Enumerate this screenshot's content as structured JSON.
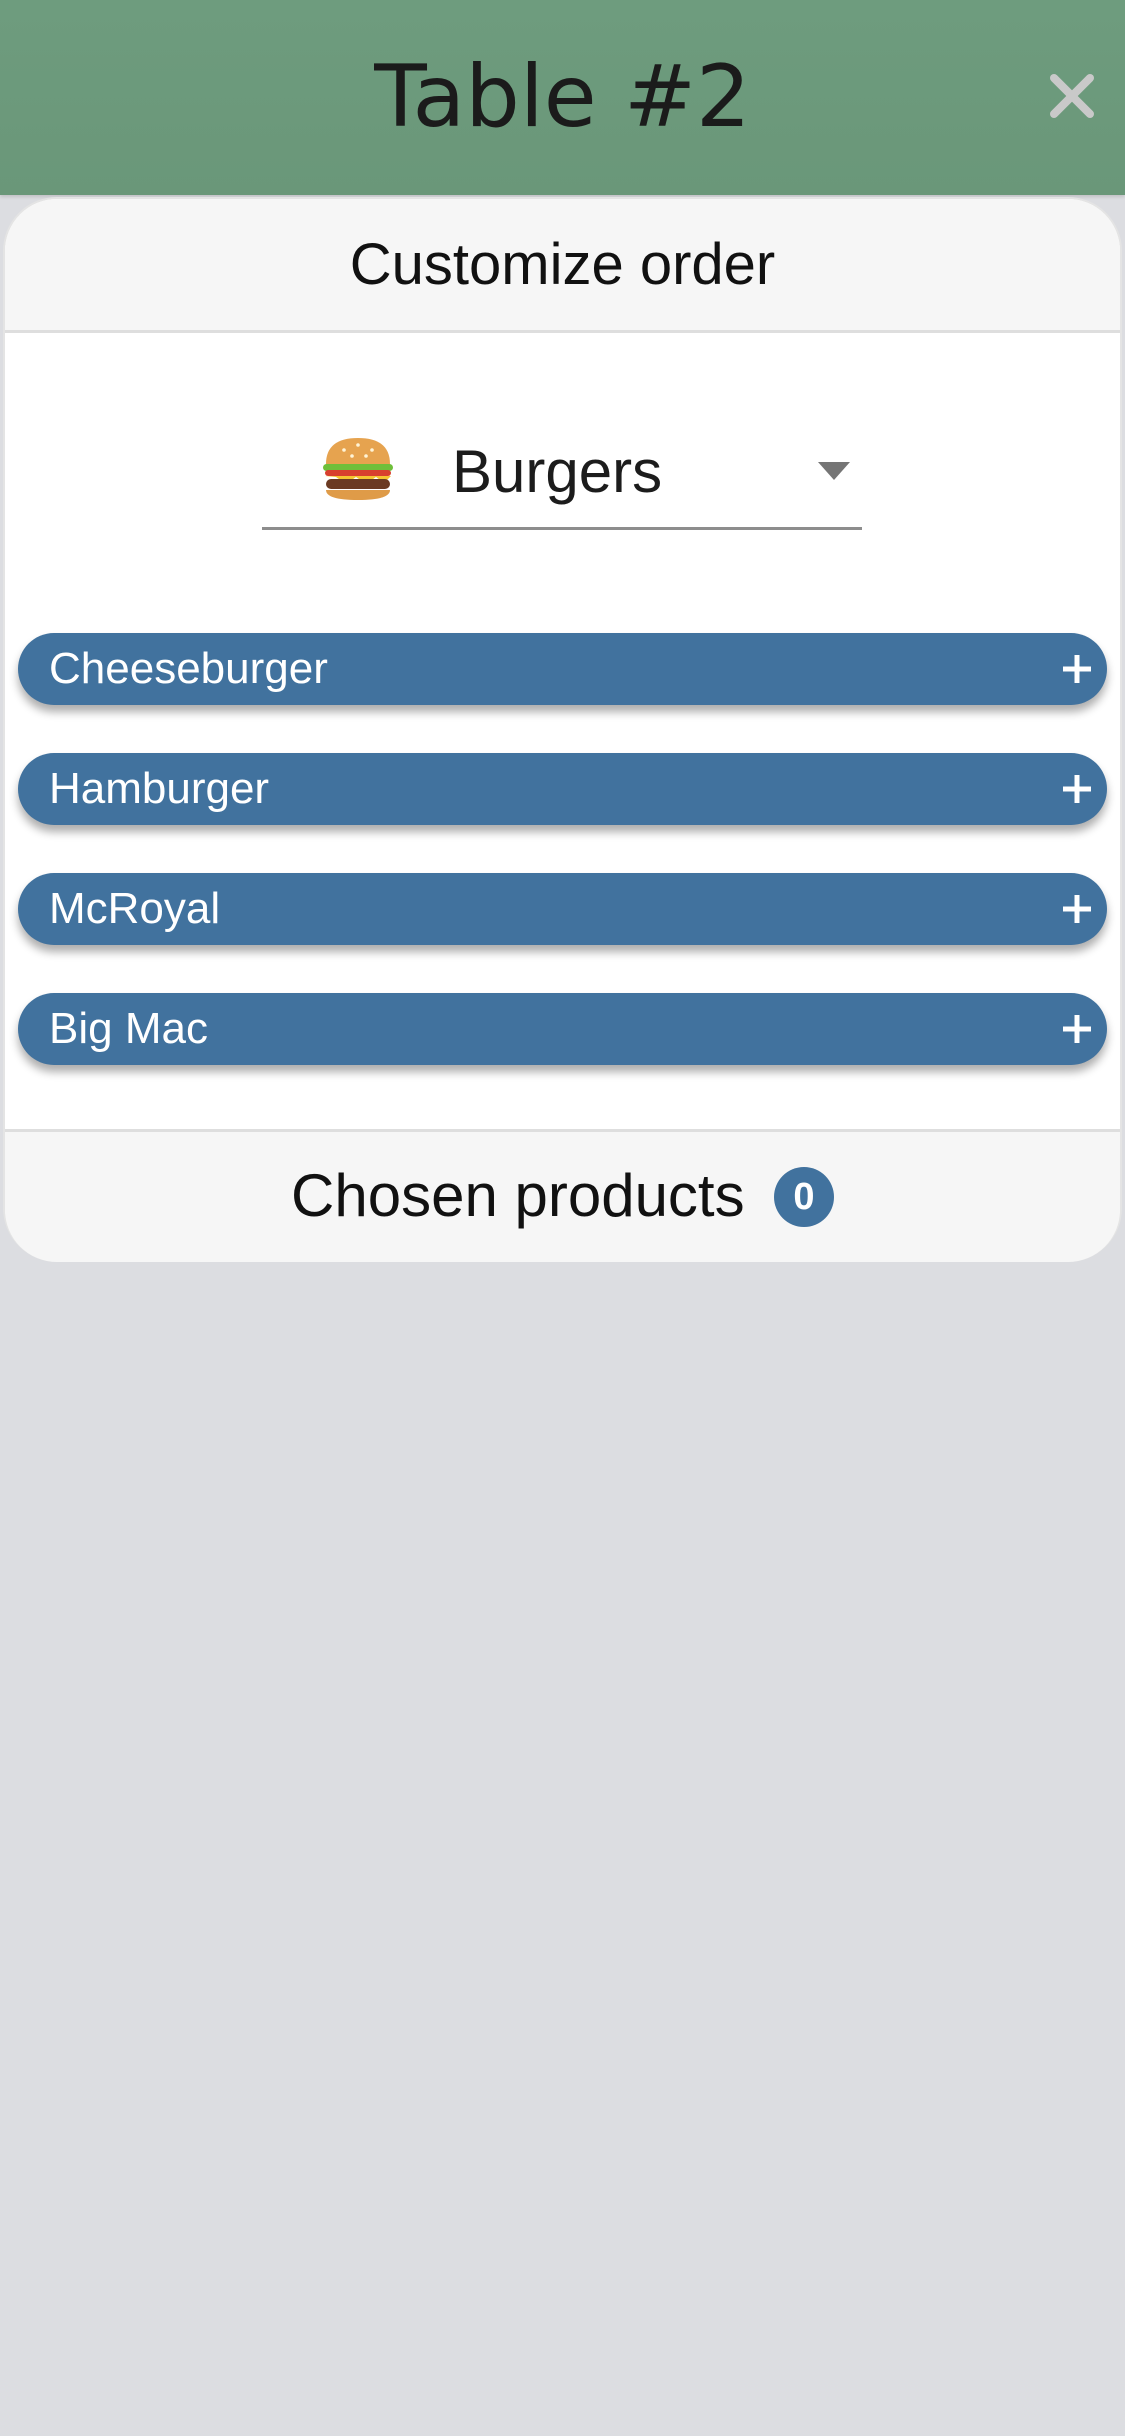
{
  "header": {
    "title": "Table #2",
    "close_icon": "close-icon"
  },
  "card": {
    "title": "Customize order",
    "category": {
      "selected": "Burgers",
      "icon": "burger-icon",
      "dropdown_icon": "caret-down-icon"
    },
    "products": [
      {
        "label": "Cheeseburger",
        "icon": "plus-icon"
      },
      {
        "label": "Hamburger",
        "icon": "plus-icon"
      },
      {
        "label": "McRoyal",
        "icon": "plus-icon"
      },
      {
        "label": "Big Mac",
        "icon": "plus-icon"
      }
    ],
    "footer": {
      "label": "Chosen products",
      "count": "0"
    }
  },
  "colors": {
    "header_bg": "#6b987a",
    "accent": "#41729e",
    "page_bg": "#dcdde1",
    "panel_bg": "#f6f6f6"
  }
}
